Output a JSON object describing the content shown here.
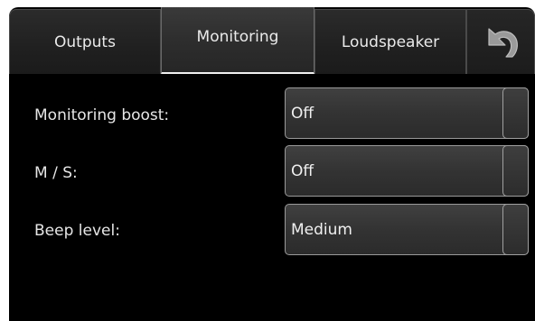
{
  "tabs": {
    "outputs": "Outputs",
    "monitoring": "Monitoring",
    "loudspeaker": "Loudspeaker",
    "back_icon": "undo-arrow-icon",
    "active": "Monitoring"
  },
  "settings": {
    "monitoring_boost": {
      "label": "Monitoring boost:",
      "value": "Off"
    },
    "ms": {
      "label": "M / S:",
      "value": "Off"
    },
    "beep_level": {
      "label": "Beep level:",
      "value": "Medium"
    }
  },
  "colors": {
    "background": "#000000",
    "text": "#e6e6e6",
    "control_border": "#9a9a9a",
    "active_tab_underline": "#f0f0f0"
  }
}
